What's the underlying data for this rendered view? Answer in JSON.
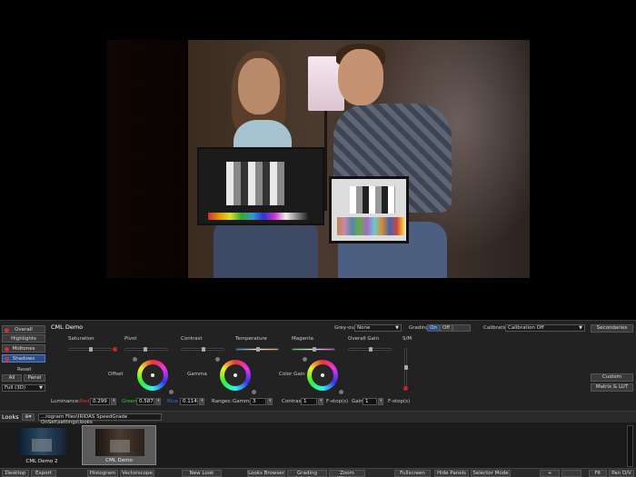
{
  "viewer": {
    "description_hidden": ""
  },
  "sidebar": {
    "overall": "Overall",
    "highlights": "Highlights",
    "midtones": "Midtones",
    "shadows": "Shadows",
    "reset": "Reset",
    "all": "All",
    "panel": "Panel",
    "mode": "Full (3D)"
  },
  "grade": {
    "look_name": "CML Demo",
    "saturation": "Saturation",
    "pivot": "Pivot",
    "contrast": "Contrast",
    "temperature": "Temperature",
    "magenta": "Magenta",
    "overall_gain": "Overall Gain",
    "sm": "S/M",
    "offset": "Offset",
    "gamma": "Gamma",
    "color_gain": "Color Gain",
    "grey_out_label": "Grey-out",
    "grey_out_value": "None",
    "grading_label": "Grading",
    "grading_on": "On",
    "grading_off": "Off",
    "calibration_label": "Calibration",
    "calibration_value": "Calibration Off",
    "secondaries": "Secondaries",
    "custom": "Custom",
    "matrix_lut": "Matrix & LUT",
    "luminance_label": "Luminance:",
    "red_label": "Red",
    "red_value": "0.299",
    "green_label": "Green",
    "green_value": "0.587",
    "blue_label": "Blue",
    "blue_value": "0.114",
    "ranges_label": "Ranges:",
    "gamma_label": "Gamma",
    "gamma_value": "3",
    "contrast_label": "Contrast",
    "contrast_value": "1",
    "fstop1": "F-stop(s)",
    "gain_label": "Gain",
    "gain_value": "1",
    "fstop2": "F-stop(s)"
  },
  "looks": {
    "label": "Looks",
    "path": "...rogram Files\\IRIDAS SpeedGrade OnSet\\settings\\looks",
    "items": [
      {
        "name": "CML Demo 2"
      },
      {
        "name": "CML Demo"
      }
    ]
  },
  "bottombar": {
    "desktop": "Desktop",
    "export": "Export",
    "histogram": "Histogram",
    "vectorscope": "Vectorscope",
    "new_look": "New Look",
    "looks_browser": "Looks Browser",
    "grading_interface": "Grading Interface",
    "zoom_window": "Zoom Window",
    "fullscreen": "Fullscreen",
    "hide_panels": "Hide Panels",
    "selector_mode": "Selector Mode",
    "plus": "+",
    "fit": "Fit",
    "pan_ov": "Pan O/V"
  }
}
